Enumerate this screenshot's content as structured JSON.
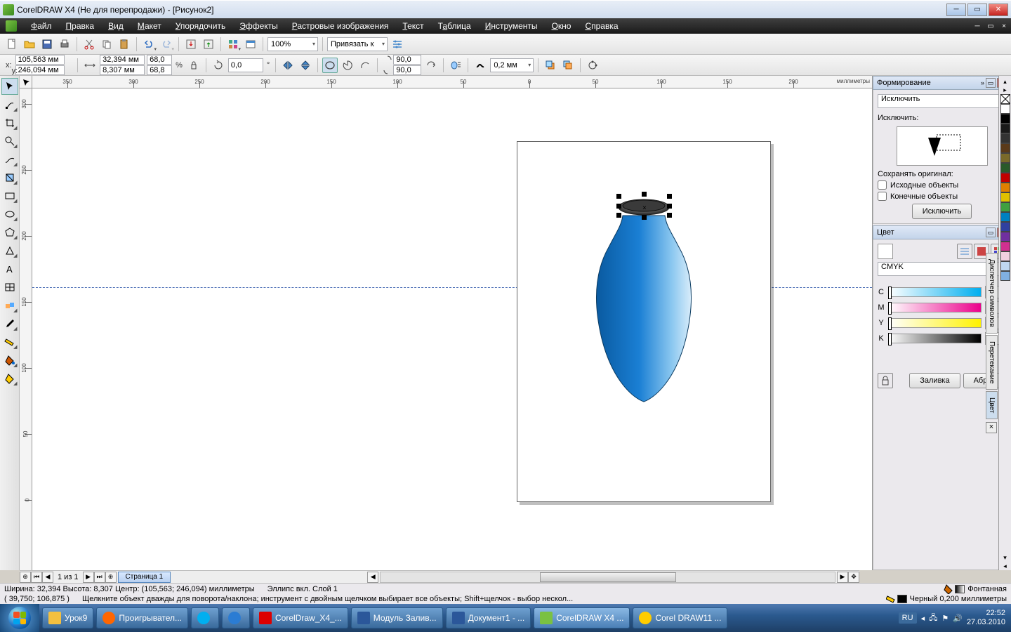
{
  "titlebar": {
    "text": "CorelDRAW X4 (Не для перепродажи) - [Рисунок2]"
  },
  "menu": [
    "Файл",
    "Правка",
    "Вид",
    "Макет",
    "Упорядочить",
    "Эффекты",
    "Растровые изображения",
    "Текст",
    "Таблица",
    "Инструменты",
    "Окно",
    "Справка"
  ],
  "toolbar1": {
    "zoom": "100%",
    "snap_label": "Привязать к"
  },
  "propbar": {
    "x_label": "x:",
    "x": "105,563 мм",
    "y_label": "y:",
    "y": "246,094 мм",
    "w": "32,394 мм",
    "h": "8,307 мм",
    "sx": "68,0",
    "sy": "68,8",
    "pct": "%",
    "rot": "0,0",
    "deg": "°",
    "a1": "90,0",
    "a2": "90,0",
    "outline": "0,2 мм"
  },
  "ruler": {
    "unit": "миллиметры",
    "h": [
      "350",
      "300",
      "250",
      "200",
      "150",
      "100",
      "50",
      "0",
      "50",
      "100",
      "150",
      "200"
    ],
    "v": [
      "300",
      "250",
      "200",
      "150",
      "100",
      "50",
      "0"
    ]
  },
  "shaping": {
    "title": "Формирование",
    "op": "Исключить",
    "label": "Исключить:",
    "keep": "Сохранять оригинал:",
    "src": "Исходные объекты",
    "tgt": "Конечные объекты",
    "apply": "Исключить"
  },
  "color": {
    "title": "Цвет",
    "model": "CMYK",
    "c": "C",
    "m": "M",
    "y": "Y",
    "k": "K",
    "c_val": "0",
    "m_val": "0",
    "y_val": "0",
    "k_val": "0",
    "fill": "Заливка",
    "outline": "Абрис"
  },
  "vtabs": [
    "Диспетчер символов",
    "Перетекание",
    "Цвет"
  ],
  "pager": {
    "pos": "1 из 1",
    "tab": "Страница 1"
  },
  "status": {
    "line1a": "Ширина: 32,394 Высота: 8,307   Центр: (105,563; 246,094)  миллиметры",
    "line1b": "Эллипс вкл. Слой 1",
    "line2a": "( 39,750; 106,875 )",
    "line2b": "Щелкните объект дважды для поворота/наклона; инструмент с двойным щелчком выбирает все объекты; Shift+щелчок - выбор нескол...",
    "fill": "Фонтанная",
    "stroke": "Черный  0,200 миллиметры"
  },
  "taskbar": {
    "items": [
      "Урок9",
      "Проигрывател...",
      "",
      "",
      "CorelDraw_X4_...",
      "Модуль Залив...",
      "Документ1 - ...",
      "CorelDRAW X4 ...",
      "Corel DRAW11 ..."
    ],
    "lang": "RU",
    "time": "22:52",
    "date": "27.03.2010"
  },
  "palette": [
    "#ffffff",
    "#000000",
    "#1a1a1a",
    "#333333",
    "#5a3a1a",
    "#7a6a2a",
    "#2a5a2a",
    "#c00000",
    "#e08000",
    "#e0c000",
    "#40a040",
    "#0080c0",
    "#3040a0",
    "#7030a0",
    "#d03090",
    "#f0d0e0",
    "#c0d8f0",
    "#80b0e0"
  ]
}
